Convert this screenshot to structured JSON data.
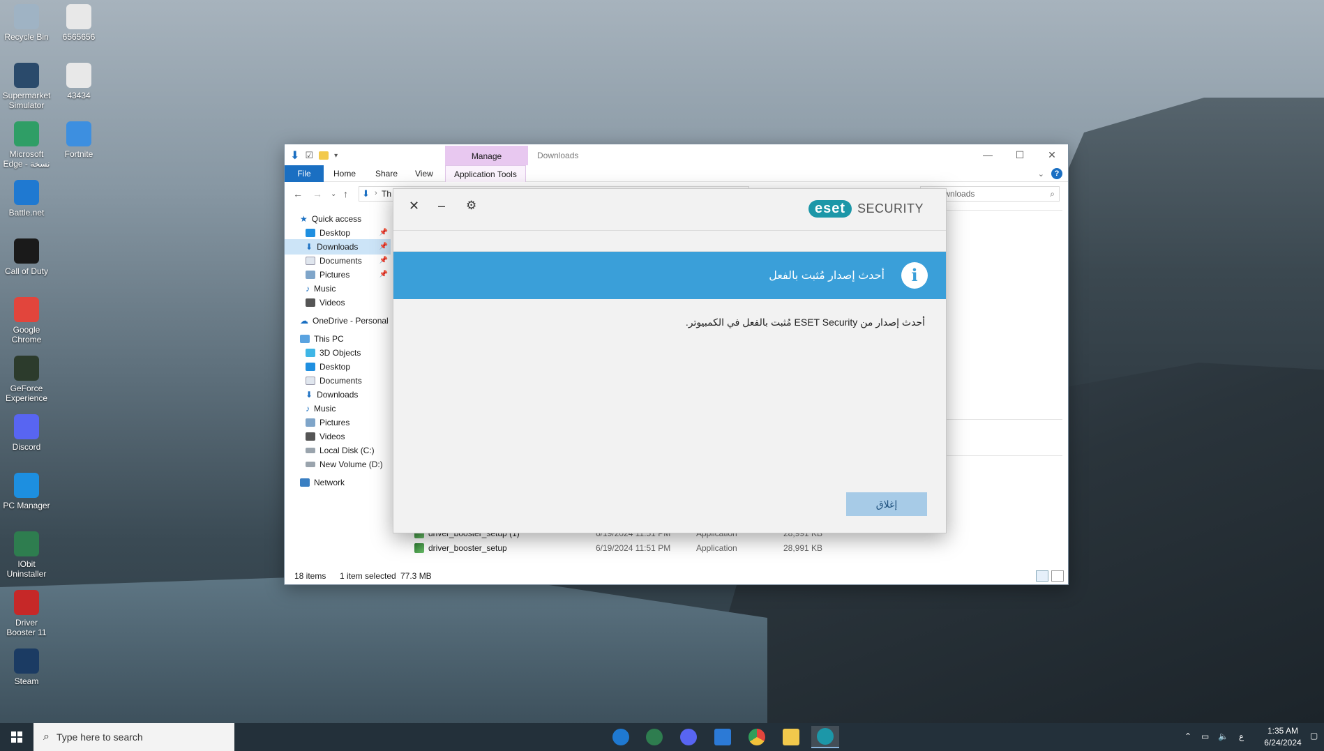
{
  "desktop": {
    "icons": [
      {
        "label": "Recycle Bin",
        "icon": "recycle-bin-icon",
        "color": "#9fb3c4"
      },
      {
        "label": "6565656",
        "icon": "file-icon",
        "color": "#e8e8e8"
      },
      {
        "label": "Supermarket Simulator",
        "icon": "supermarket-simulator-icon",
        "color": "#2a4a6b"
      },
      {
        "label": "43434",
        "icon": "file-icon",
        "color": "#e8e8e8"
      },
      {
        "label": "Microsoft Edge - نسخة",
        "icon": "edge-icon",
        "color": "#2f9e66"
      },
      {
        "label": "Fortnite",
        "icon": "fortnite-icon",
        "color": "#3d8fe0"
      },
      {
        "label": "Battle.net",
        "icon": "battlenet-icon",
        "color": "#1f79d1"
      },
      {
        "label": "Call of Duty",
        "icon": "call-of-duty-icon",
        "color": "#1a1a1a"
      },
      {
        "label": "Google Chrome",
        "icon": "chrome-icon",
        "color": "#e2453c"
      },
      {
        "label": "GeForce Experience",
        "icon": "geforce-icon",
        "color": "#2c3b2c"
      },
      {
        "label": "Discord",
        "icon": "discord-icon",
        "color": "#5865f2"
      },
      {
        "label": "PC Manager",
        "icon": "pc-manager-icon",
        "color": "#1d8fe0"
      },
      {
        "label": "IObit Uninstaller",
        "icon": "iobit-uninstaller-icon",
        "color": "#2e7d4f"
      },
      {
        "label": "Driver Booster 11",
        "icon": "driver-booster-icon",
        "color": "#c62828"
      },
      {
        "label": "Steam",
        "icon": "steam-icon",
        "color": "#1b3b63"
      }
    ]
  },
  "explorer": {
    "title": "Downloads",
    "manage_tab": "Manage",
    "tabs": [
      "File",
      "Home",
      "Share",
      "View",
      "Application Tools"
    ],
    "address_partial": "Th",
    "search_placeholder": "n Downloads",
    "nav": {
      "quick_access": "Quick access",
      "quick_items": [
        "Desktop",
        "Downloads",
        "Documents",
        "Pictures",
        "Music",
        "Videos"
      ],
      "onedrive": "OneDrive - Personal",
      "this_pc": "This PC",
      "pc_items": [
        "3D Objects",
        "Desktop",
        "Documents",
        "Downloads",
        "Music",
        "Pictures",
        "Videos",
        "Local Disk (C:)",
        "New Volume (D:)"
      ],
      "network": "Network"
    },
    "files": [
      {
        "name": "driver_booster_setup (1)",
        "date": "6/19/2024 11:51 PM",
        "type": "Application",
        "size": "28,991 KB"
      },
      {
        "name": "driver_booster_setup",
        "date": "6/19/2024 11:51 PM",
        "type": "Application",
        "size": "28,991 KB"
      }
    ],
    "status": {
      "items": "18 items",
      "selected": "1 item selected",
      "size": "77.3 MB"
    }
  },
  "eset": {
    "brand_pill": "eset",
    "brand_word": "SECURITY",
    "banner_title": "أحدث إصدار مُثبت بالفعل",
    "message": "أحدث إصدار من ESET Security مُثبت بالفعل في الكمبيوتر.",
    "close_button": "إغلاق",
    "banner_color": "#3a9fd9"
  },
  "taskbar": {
    "search_placeholder": "Type here to search",
    "time": "1:35 AM",
    "date": "6/24/2024",
    "lang": "ع"
  }
}
